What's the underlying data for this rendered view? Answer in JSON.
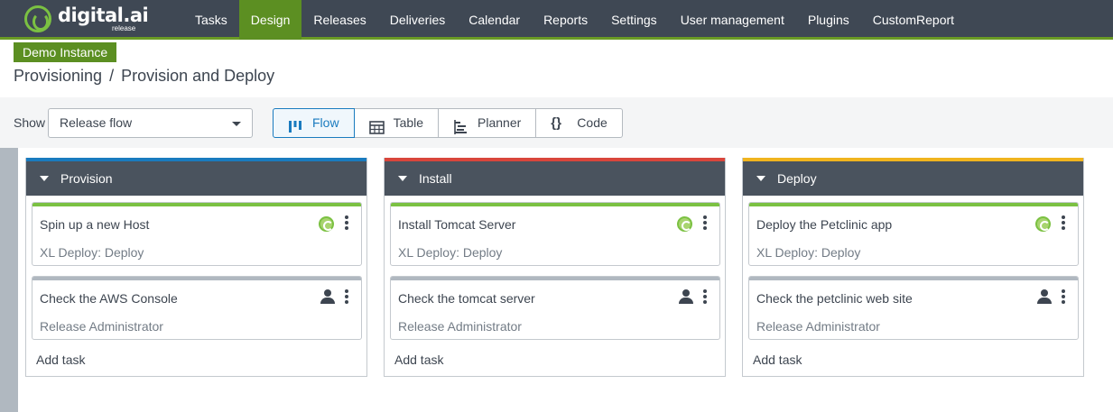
{
  "app": {
    "logo_text": "digital.ai",
    "logo_sub": "release"
  },
  "nav": {
    "items": [
      {
        "label": "Tasks"
      },
      {
        "label": "Design",
        "active": true
      },
      {
        "label": "Releases"
      },
      {
        "label": "Deliveries"
      },
      {
        "label": "Calendar"
      },
      {
        "label": "Reports"
      },
      {
        "label": "Settings"
      },
      {
        "label": "User management"
      },
      {
        "label": "Plugins"
      },
      {
        "label": "CustomReport"
      }
    ]
  },
  "instance_badge": "Demo Instance",
  "breadcrumb": {
    "parent": "Provisioning",
    "separator": "/",
    "current": "Provision and Deploy"
  },
  "toolbar": {
    "show_label": "Show",
    "show_value": "Release flow",
    "views": [
      {
        "label": "Flow",
        "icon": "flow-icon",
        "active": true
      },
      {
        "label": "Table",
        "icon": "table-icon"
      },
      {
        "label": "Planner",
        "icon": "planner-icon"
      },
      {
        "label": "Code",
        "icon": "code-icon"
      }
    ]
  },
  "colors": {
    "nav_bg": "#3f4854",
    "nav_active": "#5c8f22",
    "accent_blue": "#1a7bbf",
    "phase_provision": "#1a7bbf",
    "phase_install": "#d9463c",
    "phase_deploy": "#f0b41e",
    "task_automated": "#7bc142",
    "task_manual": "#b0b8c0"
  },
  "phases": [
    {
      "name": "Provision",
      "tasks": [
        {
          "title": "Spin up a new Host",
          "owner": "XL Deploy: Deploy",
          "type": "automated",
          "icon": "deploy-icon"
        },
        {
          "title": "Check the AWS Console",
          "owner": "Release Administrator",
          "type": "manual",
          "icon": "user-icon"
        }
      ],
      "add_task": "Add task"
    },
    {
      "name": "Install",
      "tasks": [
        {
          "title": "Install Tomcat Server",
          "owner": "XL Deploy: Deploy",
          "type": "automated",
          "icon": "deploy-icon"
        },
        {
          "title": "Check the tomcat server",
          "owner": "Release Administrator",
          "type": "manual",
          "icon": "user-icon"
        }
      ],
      "add_task": "Add task"
    },
    {
      "name": "Deploy",
      "tasks": [
        {
          "title": "Deploy the Petclinic app",
          "owner": "XL Deploy: Deploy",
          "type": "automated",
          "icon": "deploy-icon"
        },
        {
          "title": "Check the petclinic web site",
          "owner": "Release Administrator",
          "type": "manual",
          "icon": "user-icon"
        }
      ],
      "add_task": "Add task"
    }
  ]
}
